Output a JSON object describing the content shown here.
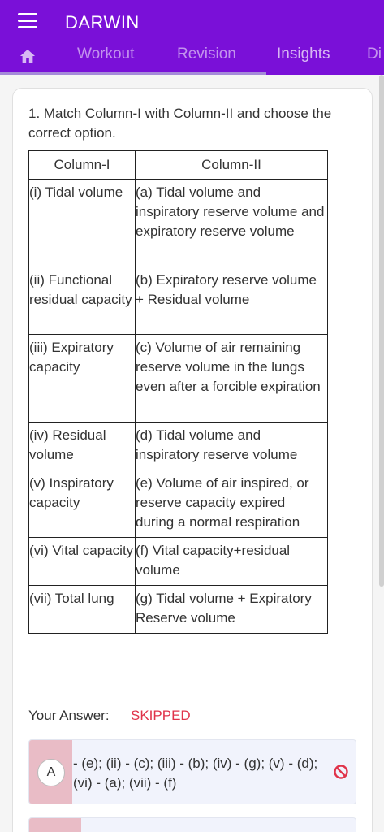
{
  "header": {
    "title": "DARWIN",
    "tabs": [
      {
        "label": "Workout"
      },
      {
        "label": "Revision"
      },
      {
        "label": "Insights"
      },
      {
        "label": "Di"
      }
    ],
    "accent_color": "#7a10d8"
  },
  "question": {
    "text": "1. Match Column-I with Column-II and choose the correct option.",
    "columns": [
      "Column-I",
      "Column-II"
    ],
    "rows": [
      {
        "c1": "(i) Tidal volume",
        "c2": "(a) Tidal volume and inspiratory reserve volume and expiratory reserve volume"
      },
      {
        "c1": "(ii) Functional residual capacity",
        "c2": "(b) Expiratory reserve volume + Residual volume"
      },
      {
        "c1": "(iii) Expiratory capacity",
        "c2": "(c) Volume of air remaining reserve volume in the lungs even after a forcible expiration"
      },
      {
        "c1": "(iv) Residual volume",
        "c2": "(d) Tidal volume and inspiratory reserve volume"
      },
      {
        "c1": "(v) Inspiratory capacity",
        "c2": "(e) Volume of air inspired, or reserve capacity expired during a normal respiration"
      },
      {
        "c1": "(vi) Vital capacity",
        "c2": "(f) Vital capacity+residual volume"
      },
      {
        "c1": "(vii) Total lung",
        "c2": "(g) Tidal volume + Expiratory Reserve volume"
      }
    ]
  },
  "answer": {
    "label": "Your Answer:",
    "value": "SKIPPED"
  },
  "options": [
    {
      "letter": "A",
      "text": "- (e); (ii) - (c); (iii) - (b); (iv) - (g); (v) - (d); (vi) - (a); (vii) - (f)",
      "icon": "ban-icon"
    }
  ]
}
